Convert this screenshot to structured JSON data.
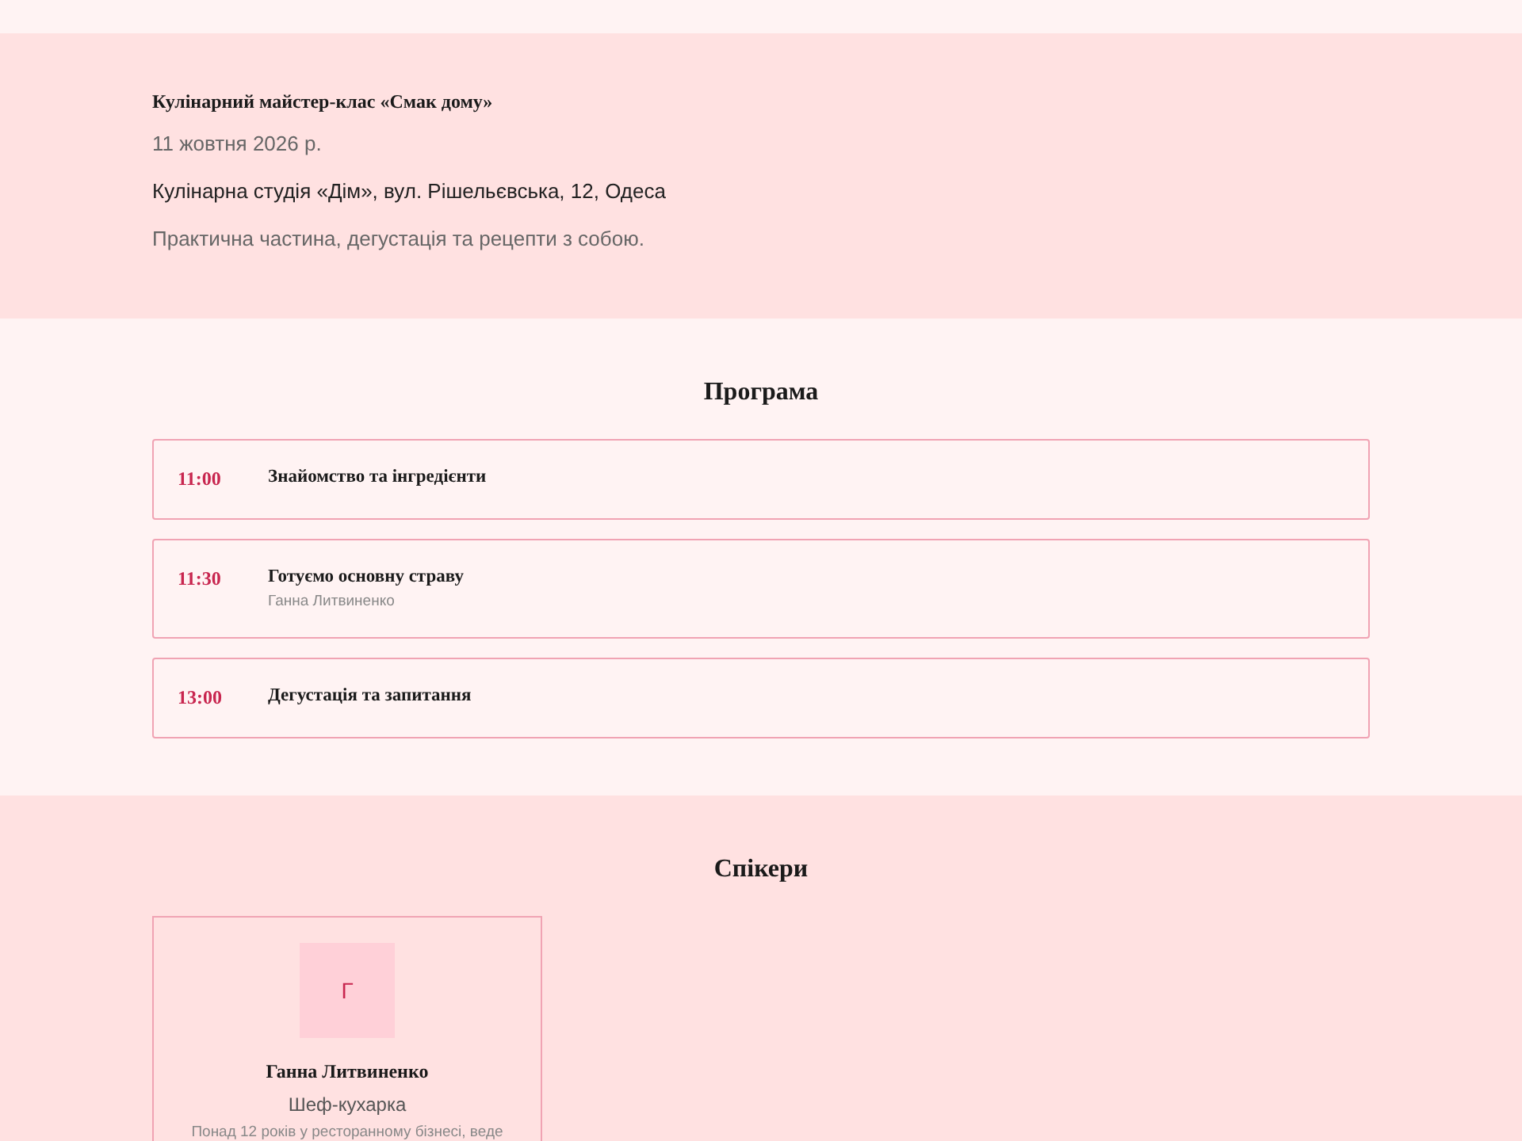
{
  "event": {
    "title": "Кулінарний майстер-клас «Смак дому»",
    "date": "11 жовтня 2026 р.",
    "venue": "Кулінарна студія «Дім», вул. Рішельєвська, 12, Одеса",
    "description": "Практична частина, дегустація та рецепти з собою."
  },
  "program": {
    "heading": "Програма",
    "items": [
      {
        "time": "11:00",
        "title": "Знайомство та інгредієнти"
      },
      {
        "time": "11:30",
        "title": "Готуємо основну страву",
        "speaker": "Ганна Литвиненко"
      },
      {
        "time": "13:00",
        "title": "Дегустація та запитання"
      }
    ]
  },
  "speakers": {
    "heading": "Спікери",
    "items": [
      {
        "initial": "Г",
        "name": "Ганна Литвиненко",
        "role": "Шеф-кухарка",
        "bio": "Понад 12 років у ресторанному бізнесі, веде"
      }
    ]
  }
}
